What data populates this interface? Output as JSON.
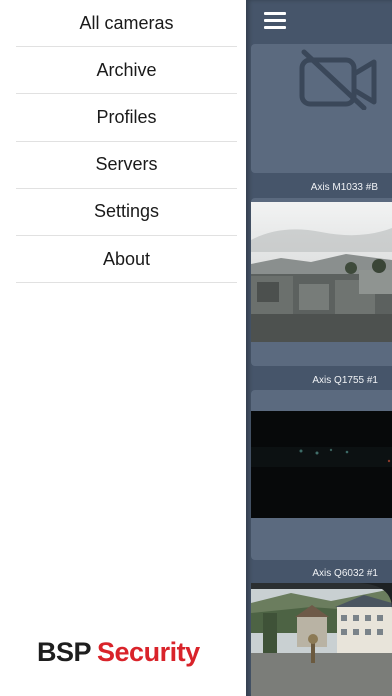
{
  "menu": {
    "items": [
      {
        "label": "All cameras"
      },
      {
        "label": "Archive"
      },
      {
        "label": "Profiles"
      },
      {
        "label": "Servers"
      },
      {
        "label": "Settings"
      },
      {
        "label": "About"
      }
    ]
  },
  "brand": {
    "part1": "BSP",
    "part2": "Security",
    "accent_color": "#d9232a"
  },
  "panel": {
    "menu_icon": "hamburger-menu-icon",
    "cameras": [
      {
        "name": "Axis M1033 #B"
      },
      {
        "name": "Axis Q1755 #1"
      },
      {
        "name": "Axis Q6032 #1"
      }
    ],
    "background_color": "#46556a"
  }
}
